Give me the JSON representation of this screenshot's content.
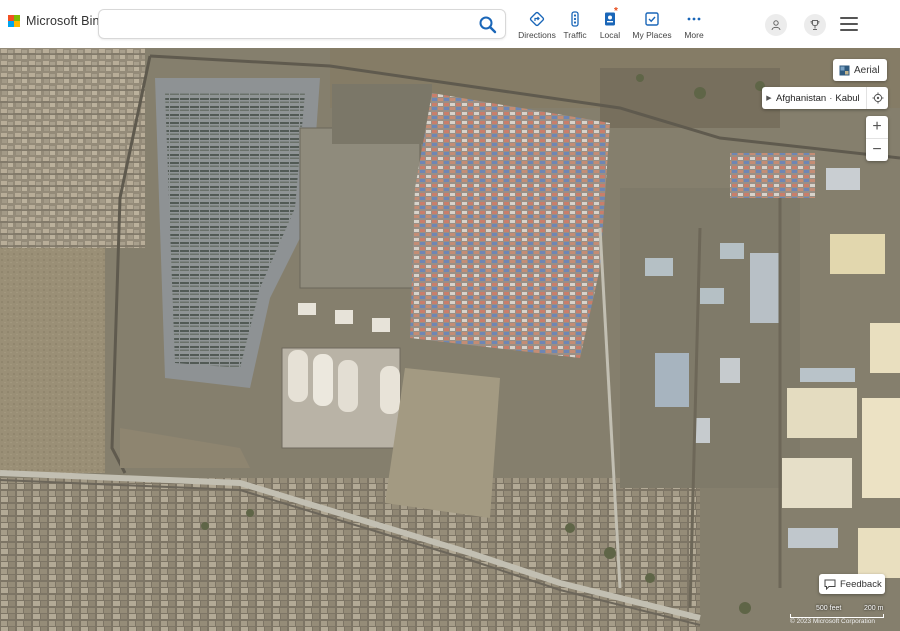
{
  "brand": {
    "name": "Microsoft Bing",
    "logo_colors": [
      "#f25022",
      "#7fba00",
      "#00a4ef",
      "#ffb900"
    ]
  },
  "search": {
    "value": "",
    "placeholder": "",
    "icon": "search-icon"
  },
  "nav": [
    {
      "label": "Directions",
      "icon": "directions-icon"
    },
    {
      "label": "Traffic",
      "icon": "traffic-icon"
    },
    {
      "label": "Local",
      "icon": "local-icon",
      "badge": "*"
    },
    {
      "label": "My Places",
      "icon": "my-places-icon"
    },
    {
      "label": "More",
      "icon": "more-dots-icon"
    }
  ],
  "header_right": {
    "account_icon": "person-icon",
    "rewards_icon": "trophy-icon",
    "menu_icon": "hamburger-icon"
  },
  "map": {
    "view": "Aerial",
    "breadcrumb": [
      "Afghanistan",
      "Kabul"
    ],
    "breadcrumb_separator": "·",
    "zoom_in": "+",
    "zoom_out": "−",
    "feedback": "Feedback",
    "scale": {
      "left_label": "500 feet",
      "right_label": "200 m"
    },
    "attribution": "© 2023 Microsoft Corporation"
  },
  "colors": {
    "accent": "#1a66b8",
    "map_ground": "#8e8a78",
    "road": "#c2bfb2"
  }
}
